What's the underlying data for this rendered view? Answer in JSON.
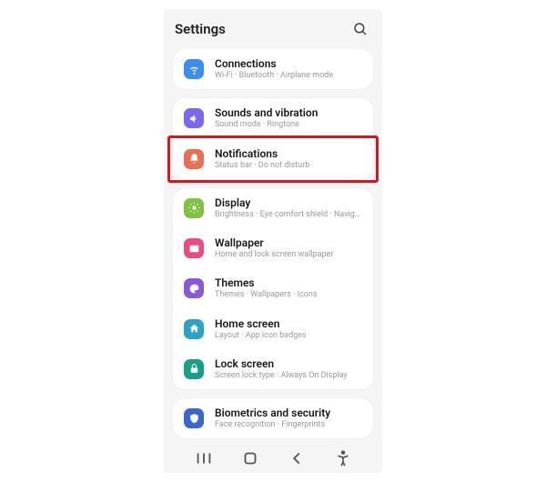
{
  "header": {
    "title": "Settings"
  },
  "colors": {
    "connections": "#3a8ef0",
    "sounds": "#7b68ee",
    "notifications": "#e86f54",
    "display": "#7fc241",
    "wallpaper": "#e94b82",
    "themes": "#8a5ad6",
    "home": "#2aa3c7",
    "lock": "#16a085",
    "biometrics": "#3a66d0"
  },
  "groups": [
    {
      "rows": [
        {
          "key": "connections",
          "title": "Connections",
          "sub": "Wi-Fi · Bluetooth · Airplane mode",
          "icon": "wifi-icon"
        }
      ]
    },
    {
      "rows": [
        {
          "key": "sounds",
          "title": "Sounds and vibration",
          "sub": "Sound mode · Ringtone",
          "icon": "sound-icon"
        },
        {
          "key": "notifications",
          "title": "Notifications",
          "sub": "Status bar · Do not disturb",
          "icon": "bell-icon",
          "highlighted": true
        }
      ]
    },
    {
      "rows": [
        {
          "key": "display",
          "title": "Display",
          "sub": "Brightness · Eye comfort shield · Navigation bar",
          "icon": "sun-icon"
        },
        {
          "key": "wallpaper",
          "title": "Wallpaper",
          "sub": "Home and lock screen wallpaper",
          "icon": "image-icon"
        },
        {
          "key": "themes",
          "title": "Themes",
          "sub": "Themes · Wallpapers · Icons",
          "icon": "palette-icon"
        },
        {
          "key": "home",
          "title": "Home screen",
          "sub": "Layout · App icon badges",
          "icon": "home-icon"
        },
        {
          "key": "lock",
          "title": "Lock screen",
          "sub": "Screen lock type · Always On Display",
          "icon": "lock-icon"
        }
      ]
    },
    {
      "rows": [
        {
          "key": "biometrics",
          "title": "Biometrics and security",
          "sub": "Face recognition · Fingerprints",
          "icon": "shield-icon"
        }
      ]
    }
  ]
}
